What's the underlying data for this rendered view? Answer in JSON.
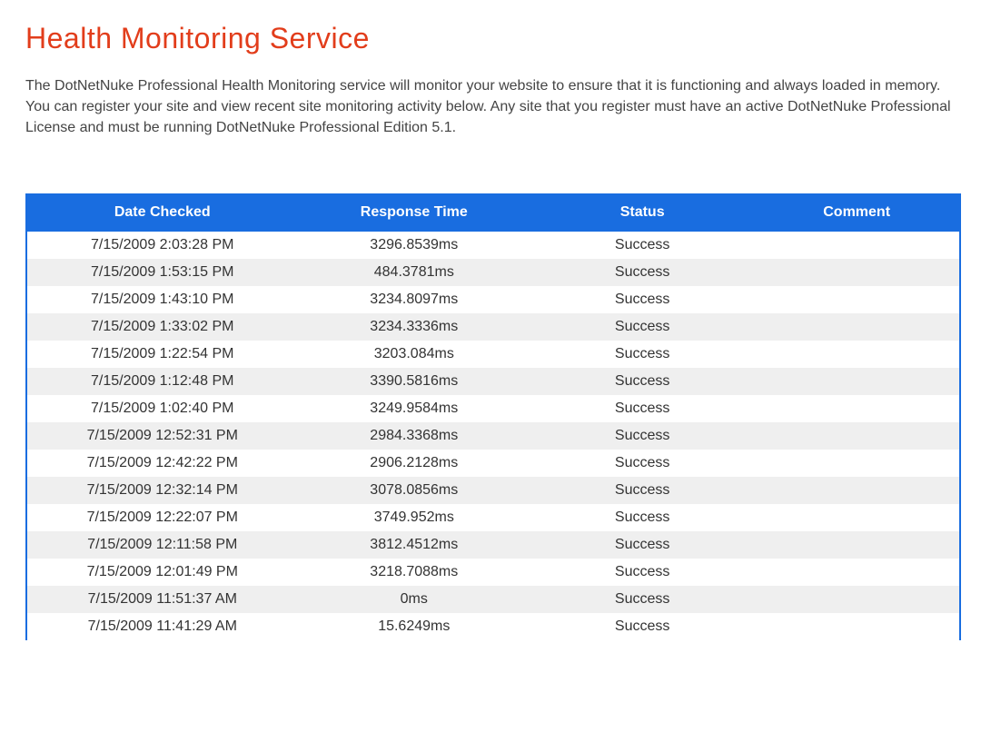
{
  "page": {
    "title": "Health Monitoring Service",
    "intro": "The DotNetNuke Professional Health Monitoring service will monitor your website to ensure that it is functioning and always loaded in memory.  You can register your site and view recent site monitoring activity below.  Any site that you register must have an active DotNetNuke Professional License and must be running DotNetNuke Professional Edition 5.1."
  },
  "table": {
    "headers": {
      "date_checked": "Date Checked",
      "response_time": "Response Time",
      "status": "Status",
      "comment": "Comment"
    },
    "rows": [
      {
        "date_checked": "7/15/2009 2:03:28 PM",
        "response_time": "3296.8539ms",
        "status": "Success",
        "comment": ""
      },
      {
        "date_checked": "7/15/2009 1:53:15 PM",
        "response_time": "484.3781ms",
        "status": "Success",
        "comment": ""
      },
      {
        "date_checked": "7/15/2009 1:43:10 PM",
        "response_time": "3234.8097ms",
        "status": "Success",
        "comment": ""
      },
      {
        "date_checked": "7/15/2009 1:33:02 PM",
        "response_time": "3234.3336ms",
        "status": "Success",
        "comment": ""
      },
      {
        "date_checked": "7/15/2009 1:22:54 PM",
        "response_time": "3203.084ms",
        "status": "Success",
        "comment": ""
      },
      {
        "date_checked": "7/15/2009 1:12:48 PM",
        "response_time": "3390.5816ms",
        "status": "Success",
        "comment": ""
      },
      {
        "date_checked": "7/15/2009 1:02:40 PM",
        "response_time": "3249.9584ms",
        "status": "Success",
        "comment": ""
      },
      {
        "date_checked": "7/15/2009 12:52:31 PM",
        "response_time": "2984.3368ms",
        "status": "Success",
        "comment": ""
      },
      {
        "date_checked": "7/15/2009 12:42:22 PM",
        "response_time": "2906.2128ms",
        "status": "Success",
        "comment": ""
      },
      {
        "date_checked": "7/15/2009 12:32:14 PM",
        "response_time": "3078.0856ms",
        "status": "Success",
        "comment": ""
      },
      {
        "date_checked": "7/15/2009 12:22:07 PM",
        "response_time": "3749.952ms",
        "status": "Success",
        "comment": ""
      },
      {
        "date_checked": "7/15/2009 12:11:58 PM",
        "response_time": "3812.4512ms",
        "status": "Success",
        "comment": ""
      },
      {
        "date_checked": "7/15/2009 12:01:49 PM",
        "response_time": "3218.7088ms",
        "status": "Success",
        "comment": ""
      },
      {
        "date_checked": "7/15/2009 11:51:37 AM",
        "response_time": "0ms",
        "status": "Success",
        "comment": ""
      },
      {
        "date_checked": "7/15/2009 11:41:29 AM",
        "response_time": "15.6249ms",
        "status": "Success",
        "comment": ""
      }
    ]
  },
  "colors": {
    "accent": "#e23d1b",
    "header_bg": "#196de0",
    "row_alt": "#efefef"
  }
}
